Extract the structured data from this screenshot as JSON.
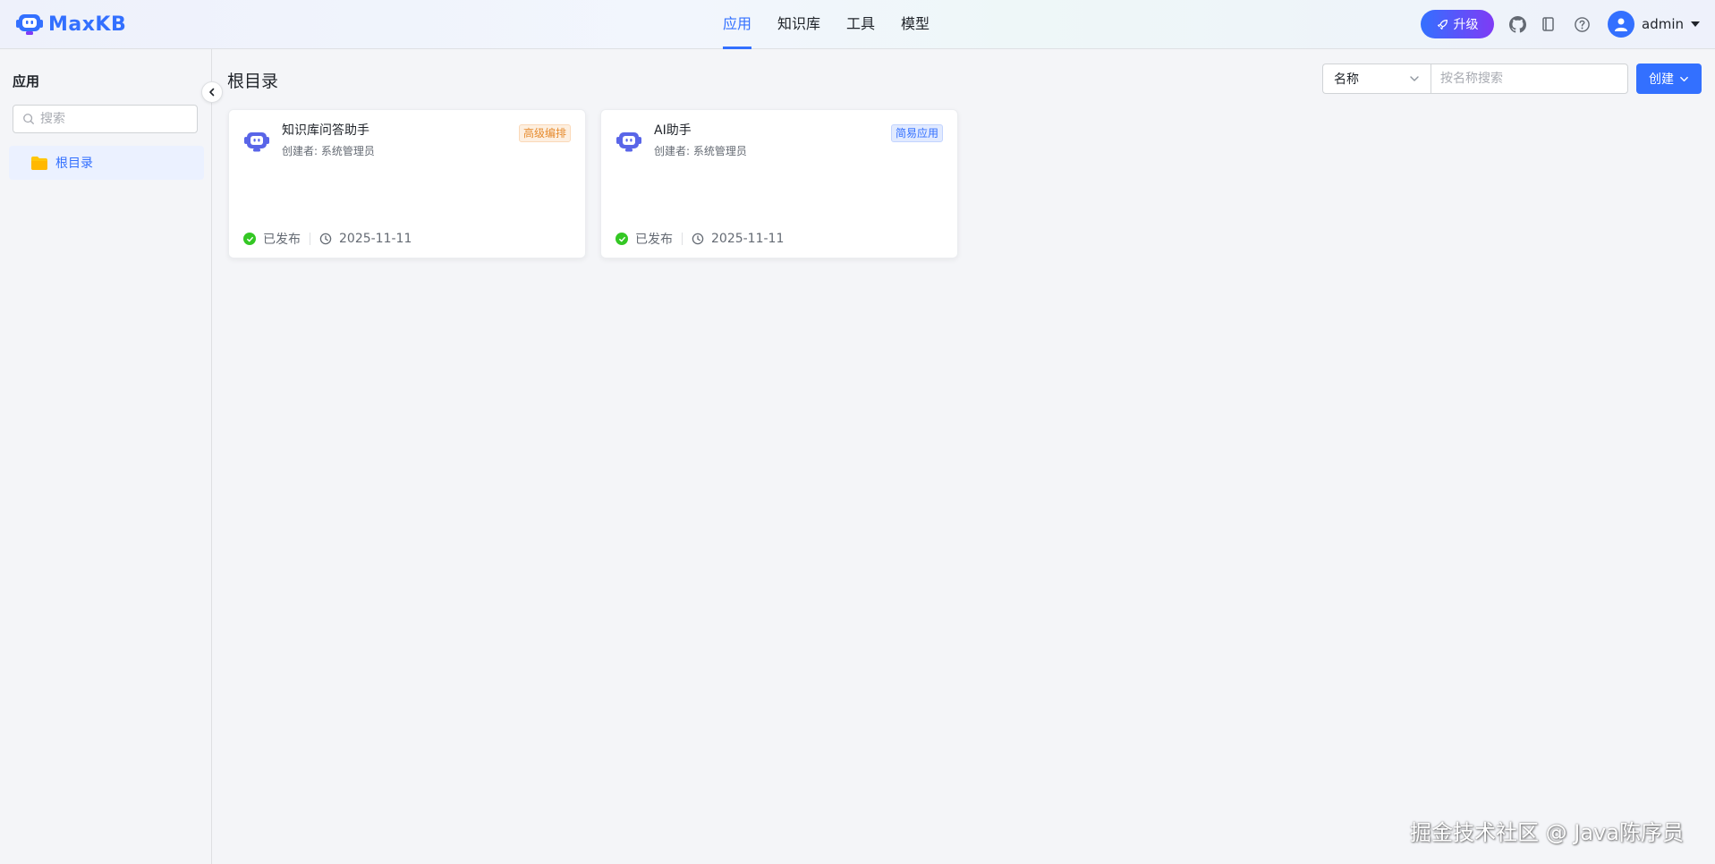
{
  "header": {
    "brand": "MaxKB",
    "nav": [
      {
        "label": "应用",
        "active": true
      },
      {
        "label": "知识库",
        "active": false
      },
      {
        "label": "工具",
        "active": false
      },
      {
        "label": "模型",
        "active": false
      }
    ],
    "upgrade_label": "升级",
    "icons": [
      "github-icon",
      "document-icon",
      "help-icon"
    ],
    "username": "admin"
  },
  "sidebar": {
    "title": "应用",
    "search_placeholder": "搜索",
    "folders": [
      {
        "label": "根目录",
        "selected": true
      }
    ]
  },
  "main": {
    "title": "根目录",
    "filter_field": "名称",
    "search_placeholder": "按名称搜索",
    "create_label": "创建",
    "apps": [
      {
        "name": "知识库问答助手",
        "creator": "创建者: 系统管理员",
        "tag": "高级编排",
        "tag_color": "orange",
        "status": "已发布",
        "date": "2025-11-11"
      },
      {
        "name": "AI助手",
        "creator": "创建者: 系统管理员",
        "tag": "简易应用",
        "tag_color": "blue",
        "status": "已发布",
        "date": "2025-11-11"
      }
    ]
  },
  "watermark": "掘金技术社区 @ Java陈序员",
  "colors": {
    "primary": "#3370ff",
    "success": "#34c724",
    "warning": "#e68b2e"
  }
}
